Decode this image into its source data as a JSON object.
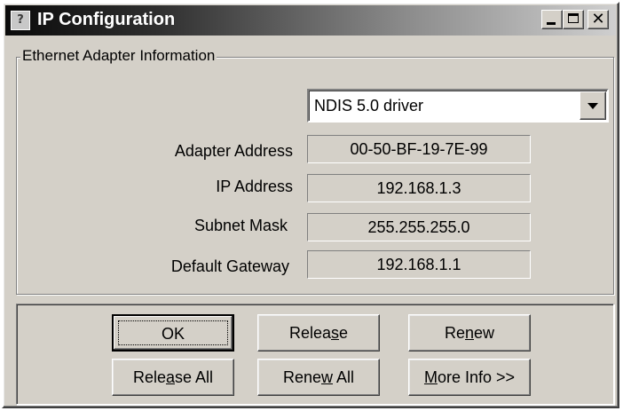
{
  "window": {
    "title": "IP Configuration",
    "icon": "network-config-icon",
    "controls": [
      "minimize",
      "maximize",
      "close"
    ],
    "close_glyph": "✕"
  },
  "adapter_group": {
    "legend": "Ethernet  Adapter Information",
    "adapter_select": {
      "selected": "NDIS 5.0 driver"
    },
    "fields": [
      {
        "label": "Adapter Address",
        "value": "00-50-BF-19-7E-99"
      },
      {
        "label": "IP Address",
        "value": "192.168.1.3"
      },
      {
        "label": "Subnet Mask",
        "value": "255.255.255.0"
      },
      {
        "label": "Default Gateway",
        "value": "192.168.1.1"
      }
    ]
  },
  "buttons": {
    "ok": {
      "pre": "OK",
      "u": "",
      "post": ""
    },
    "release": {
      "pre": "Relea",
      "u": "s",
      "post": "e"
    },
    "renew": {
      "pre": "Re",
      "u": "n",
      "post": "ew"
    },
    "release_all": {
      "pre": "Rele",
      "u": "a",
      "post": "se All"
    },
    "renew_all": {
      "pre": "Rene",
      "u": "w",
      "post": " All"
    },
    "more_info": {
      "pre": "",
      "u": "M",
      "post": "ore Info >>"
    }
  }
}
